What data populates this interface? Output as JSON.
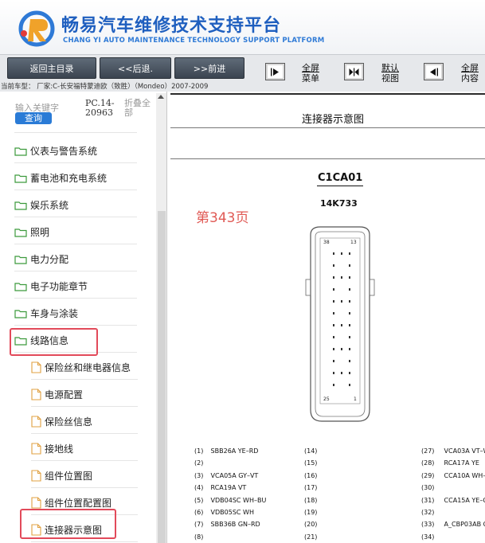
{
  "header": {
    "title": "畅易汽车维修技术支持平台",
    "subtitle": "CHANG YI AUTO MAINTENANCE TECHNOLOGY SUPPORT PLATFORM"
  },
  "toolbar": {
    "back_home": "返回主目录",
    "prev": "<<后退.",
    "next": ">>前进",
    "fullscreen_menu": [
      "全屏",
      "菜单"
    ],
    "default_view": [
      "默认",
      "视图"
    ],
    "fullscreen_content": [
      "全屏",
      "内容"
    ]
  },
  "vehicle_line": "当前车型：  厂家:C-长安福特蒙迪欧（致胜）（Mondeo）2007-2009",
  "sidebar": {
    "search_placeholder": "输入关键字",
    "search_button": "查询",
    "model_code": "PC.14-20963",
    "collapse_all": "折叠全部",
    "folders": [
      {
        "label": "仪表与警告系统"
      },
      {
        "label": "蓄电池和充电系统"
      },
      {
        "label": "娱乐系统"
      },
      {
        "label": "照明"
      },
      {
        "label": "电力分配"
      },
      {
        "label": "电子功能章节"
      },
      {
        "label": "车身与涂装"
      },
      {
        "label": "线路信息"
      }
    ],
    "children": [
      {
        "label": "保险丝和继电器信息"
      },
      {
        "label": "电源配置"
      },
      {
        "label": "保险丝信息"
      },
      {
        "label": "接地线"
      },
      {
        "label": "组件位置图"
      },
      {
        "label": "组件位置配置图"
      },
      {
        "label": "连接器示意图"
      }
    ]
  },
  "main": {
    "doc_title": "连接器示意图",
    "connector_id": "C1CA01",
    "connector_part": "14K733",
    "page_tag": "第343页",
    "pin_labels": {
      "top_left": "38",
      "top_right": "13",
      "bottom_left": "25",
      "bottom_right": "1"
    },
    "pins_col1": [
      {
        "num": "(1)",
        "wire": "SBB26A YE–RD"
      },
      {
        "num": "(2)",
        "wire": ""
      },
      {
        "num": "(3)",
        "wire": "VCA05A GY–VT"
      },
      {
        "num": "(4)",
        "wire": "RCA19A VT"
      },
      {
        "num": "(5)",
        "wire": "VDB04SC WH–BU"
      },
      {
        "num": "(6)",
        "wire": "VDB05SC WH"
      },
      {
        "num": "(7)",
        "wire": "SBB36B GN–RD"
      },
      {
        "num": "(8)",
        "wire": ""
      }
    ],
    "pins_col2": [
      {
        "num": "(14)"
      },
      {
        "num": "(15)"
      },
      {
        "num": "(16)"
      },
      {
        "num": "(17)"
      },
      {
        "num": "(18)"
      },
      {
        "num": "(19)"
      },
      {
        "num": "(20)"
      },
      {
        "num": "(21)"
      }
    ],
    "pins_col3": [
      {
        "num": "(27)",
        "wire": "VCA03A VT–W"
      },
      {
        "num": "(28)",
        "wire": "RCA17A YE"
      },
      {
        "num": "(29)",
        "wire": "CCA10A WH–"
      },
      {
        "num": "(30)",
        "wire": ""
      },
      {
        "num": "(31)",
        "wire": "CCA15A YE–G"
      },
      {
        "num": "(32)",
        "wire": ""
      },
      {
        "num": "(33)",
        "wire": "A_CBP03AB G"
      },
      {
        "num": "(34)",
        "wire": ""
      }
    ]
  },
  "colors": {
    "brand_blue": "#1f5fbf",
    "search_button": "#2a7bd6",
    "highlight_red": "#e24a5a",
    "page_tag_red": "#e05a55",
    "folder_green": "#3c9a3c"
  }
}
